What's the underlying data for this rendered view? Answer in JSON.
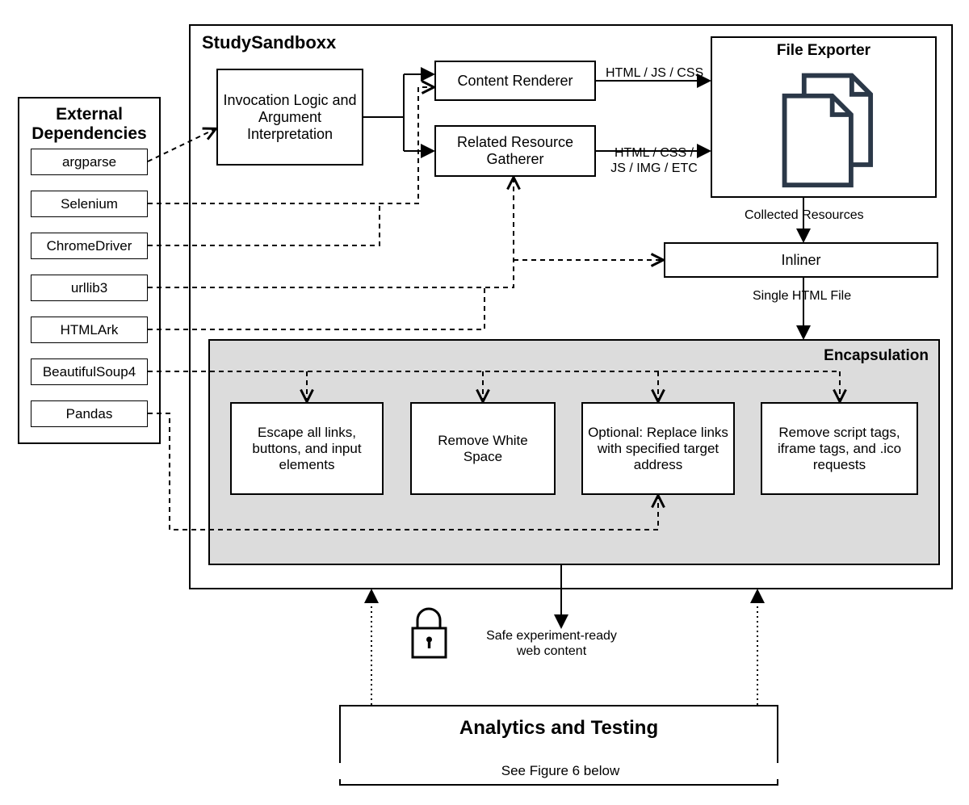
{
  "external_dependencies": {
    "title": "External Dependencies",
    "items": [
      "argparse",
      "Selenium",
      "ChromeDriver",
      "urllib3",
      "HTMLArk",
      "BeautifulSoup4",
      "Pandas"
    ]
  },
  "main_container": {
    "title": "StudySandboxx",
    "invocation": "Invocation Logic and Argument Interpretation",
    "content_renderer": "Content Renderer",
    "related_resource_gatherer": "Related Resource Gatherer",
    "file_exporter_title": "File Exporter",
    "inliner": "Inliner",
    "encapsulation": {
      "title": "Encapsulation",
      "steps": [
        "Escape all links, buttons, and input elements",
        "Remove White Space",
        "Optional: Replace links with specified target address",
        "Remove script tags, iframe tags, and .ico requests"
      ]
    }
  },
  "edge_labels": {
    "html_js_css": "HTML / JS / CSS",
    "html_css_js_img_etc": "HTML / CSS / JS / IMG / ETC",
    "collected_resources": "Collected Resources",
    "single_html_file": "Single HTML File",
    "safe_content": "Safe experiment-ready web content"
  },
  "analytics": {
    "title": "Analytics and Testing",
    "subtitle": "See Figure 6 below"
  }
}
